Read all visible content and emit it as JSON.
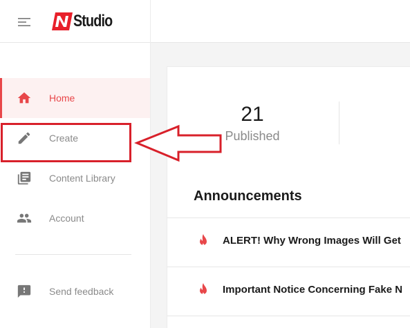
{
  "header": {
    "logo_text": "Studio",
    "brand_color": "#e8202a"
  },
  "sidebar": {
    "items": [
      {
        "label": "Home",
        "icon": "home-icon",
        "active": true
      },
      {
        "label": "Create",
        "icon": "pencil-icon",
        "active": false
      },
      {
        "label": "Content Library",
        "icon": "library-icon",
        "active": false
      },
      {
        "label": "Account",
        "icon": "people-icon",
        "active": false
      }
    ],
    "feedback": {
      "label": "Send feedback",
      "icon": "feedback-icon"
    }
  },
  "main": {
    "stats": [
      {
        "value": "21",
        "label": "Published"
      }
    ],
    "announcements_title": "Announcements",
    "announcements": [
      {
        "text": "ALERT! Why Wrong Images Will Get",
        "icon": "flame-icon"
      },
      {
        "text": "Important Notice Concerning Fake N",
        "icon": "flame-icon"
      }
    ]
  },
  "colors": {
    "accent": "#e8474a",
    "annotation": "#d8202a",
    "muted_text": "#8a8a8a"
  }
}
